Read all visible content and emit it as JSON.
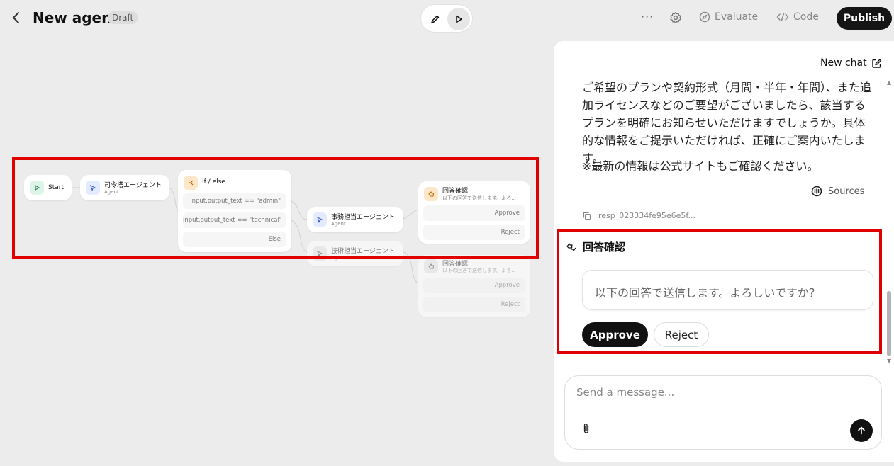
{
  "header": {
    "back_icon": "chevron-left-icon",
    "title": "New agent",
    "status_badge": "Draft",
    "more_label": "···",
    "evaluate_label": "Evaluate",
    "code_label": "Code",
    "publish_label": "Publish"
  },
  "canvas": {
    "start": {
      "label": "Start"
    },
    "commander_agent": {
      "label": "司令塔エージェント",
      "sub": "Agent"
    },
    "if_else": {
      "label": "If / else",
      "conditions": [
        "input.output_text == \"admin\"",
        "input.output_text == \"technical\""
      ],
      "else_label": "Else"
    },
    "office_agent": {
      "label": "事務担当エージェント",
      "sub": "Agent"
    },
    "tech_agent": {
      "label": "技術担当エージェント",
      "sub": "Agent"
    },
    "approval_1": {
      "label": "回答確認",
      "sub": "以下の回答で送信します。よろ...",
      "approve": "Approve",
      "reject": "Reject"
    },
    "approval_2": {
      "label": "回答確認",
      "sub": "以下の回答で送信します。よろ...",
      "approve": "Approve",
      "reject": "Reject"
    }
  },
  "chat": {
    "new_chat_label": "New chat",
    "paragraphs": [
      "ご希望のプランや契約形式（月間・半年・年間）、また追加ライセンスなどのご要望がございましたら、該当するプランを明確にお知らせいただけますでしょうか。具体的な情報をご提示いただければ、正確にご案内いたします。",
      "※最新の情報は公式サイトもご確認ください。"
    ],
    "sources_label": "Sources",
    "response_id": "resp_023334fe95e6e5f...",
    "approval": {
      "title": "回答確認",
      "message": "以下の回答で送信します。よろしいですか？",
      "approve_label": "Approve",
      "reject_label": "Reject"
    },
    "composer": {
      "placeholder": "Send a message...",
      "value": ""
    }
  },
  "colors": {
    "highlight": "#e00000",
    "primary_button": "#151515",
    "canvas_bg": "#ececec"
  }
}
